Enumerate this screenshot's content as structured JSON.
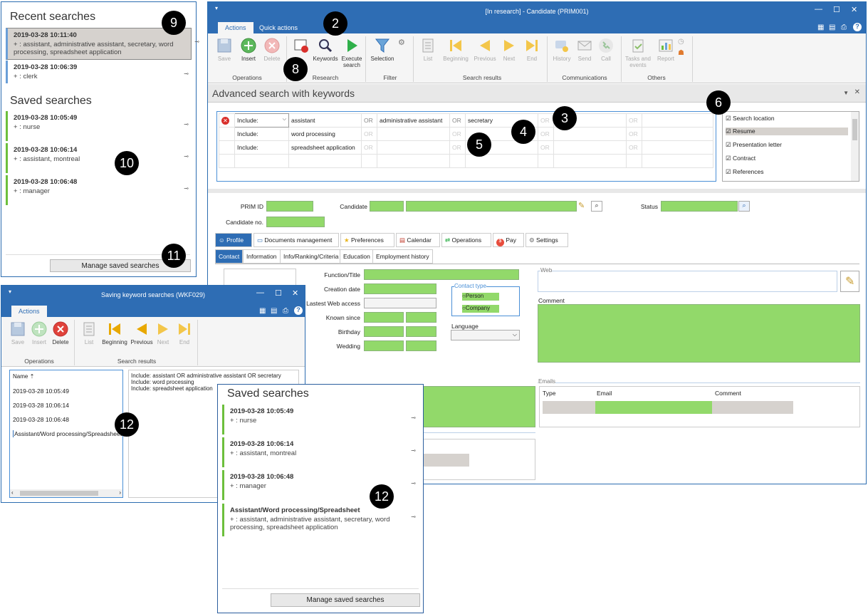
{
  "main_window": {
    "title": "[In research] - Candidate (PRIM001)",
    "tabs": [
      "Actions",
      "Quick actions"
    ],
    "ribbon": {
      "operations": {
        "label": "Operations",
        "buttons": [
          "Save",
          "Insert",
          "Delete"
        ]
      },
      "research": {
        "label": "Research",
        "buttons": [
          "Keywords",
          "Execute search"
        ]
      },
      "filter": {
        "label": "Filter",
        "buttons": [
          "Selection"
        ]
      },
      "search_results": {
        "label": "Search results",
        "buttons": [
          "List",
          "Beginning",
          "Previous",
          "Next",
          "End"
        ]
      },
      "communications": {
        "label": "Communications",
        "buttons": [
          "History",
          "Send",
          "Call"
        ]
      },
      "others": {
        "label": "Others",
        "buttons": [
          "Tasks and events",
          "Report"
        ]
      }
    },
    "adv_search": {
      "title": "Advanced search with keywords",
      "rows": [
        {
          "mode": "Include:",
          "terms": [
            "assistant",
            "administrative assistant",
            "secretary",
            "",
            ""
          ]
        },
        {
          "mode": "Include:",
          "terms": [
            "word processing",
            "",
            "",
            "",
            ""
          ]
        },
        {
          "mode": "Include:",
          "terms": [
            "spreadsheet application",
            "",
            "",
            "",
            ""
          ]
        }
      ],
      "or_label": "OR",
      "locations": [
        {
          "label": "Search location",
          "checked": true
        },
        {
          "label": "Resume",
          "checked": true
        },
        {
          "label": "Presentation letter",
          "checked": true
        },
        {
          "label": "Contract",
          "checked": true
        },
        {
          "label": "References",
          "checked": true
        }
      ]
    },
    "form": {
      "prim_id_label": "PRIM ID",
      "candidate_label": "Candidate",
      "status_label": "Status",
      "candidate_no_label": "Candidate no.",
      "main_tabs": [
        "Profile",
        "Documents management",
        "Preferences",
        "Calendar",
        "Operations",
        "Pay",
        "Settings"
      ],
      "sub_tabs": [
        "Contact",
        "Information",
        "Info/Ranking/Criteria",
        "Education",
        "Employment history"
      ],
      "fields": [
        "Function/Title",
        "Creation date",
        "Lastest Web access",
        "Known since",
        "Birthday",
        "Wedding"
      ],
      "contact_type_label": "Contact type",
      "contact_types": [
        "Person",
        "Company"
      ],
      "language_label": "Language",
      "web_label": "Web",
      "comment_label": "Comment",
      "emails_label": "Emails",
      "emails_columns": [
        "Type",
        "Email",
        "Comment"
      ]
    }
  },
  "recent_panel": {
    "recent_title": "Recent searches",
    "recent": [
      {
        "date": "2019-03-28 10:11:40",
        "value": "+ : assistant, administrative assistant, secretary, word processing, spreadsheet application"
      },
      {
        "date": "2019-03-28 10:06:39",
        "value": "+ : clerk"
      }
    ],
    "saved_title": "Saved searches",
    "saved": [
      {
        "date": "2019-03-28 10:05:49",
        "value": "+ : nurse"
      },
      {
        "date": "2019-03-28 10:06:14",
        "value": "+ : assistant, montreal"
      },
      {
        "date": "2019-03-28 10:06:48",
        "value": "+ : manager"
      }
    ],
    "manage_label": "Manage saved searches"
  },
  "saving_window": {
    "title": "Saving keyword searches (WKF029)",
    "tab": "Actions",
    "buttons_ops": [
      "Save",
      "Insert",
      "Delete"
    ],
    "buttons_res": [
      "List",
      "Beginning",
      "Previous",
      "Next",
      "End"
    ],
    "ops_label": "Operations",
    "res_label": "Search results",
    "list_header": "Name",
    "list": [
      "2019-03-28 10:05:49",
      "2019-03-28 10:06:14",
      "2019-03-28 10:06:48",
      "Assistant/Word processing/Spreadsheet"
    ],
    "detail": [
      "Include: assistant OR administrative assistant OR secretary",
      "Include: word processing",
      "Include: spreadsheet application"
    ]
  },
  "saved_popup": {
    "title": "Saved searches",
    "items": [
      {
        "date": "2019-03-28 10:05:49",
        "value": "+ : nurse"
      },
      {
        "date": "2019-03-28 10:06:14",
        "value": "+ : assistant, montreal"
      },
      {
        "date": "2019-03-28 10:06:48",
        "value": "+ : manager"
      },
      {
        "date": "Assistant/Word processing/Spreadsheet",
        "value": "+ : assistant, administrative assistant, secretary, word processing, spreadsheet application"
      }
    ],
    "manage_label": "Manage saved searches"
  },
  "callouts": [
    "2",
    "3",
    "4",
    "5",
    "6",
    "8",
    "9",
    "10",
    "11",
    "12",
    "12"
  ],
  "colors": {
    "title_blue": "#2e6db4",
    "field_green": "#92d96a",
    "saved_bar": "#6cbf3c"
  }
}
